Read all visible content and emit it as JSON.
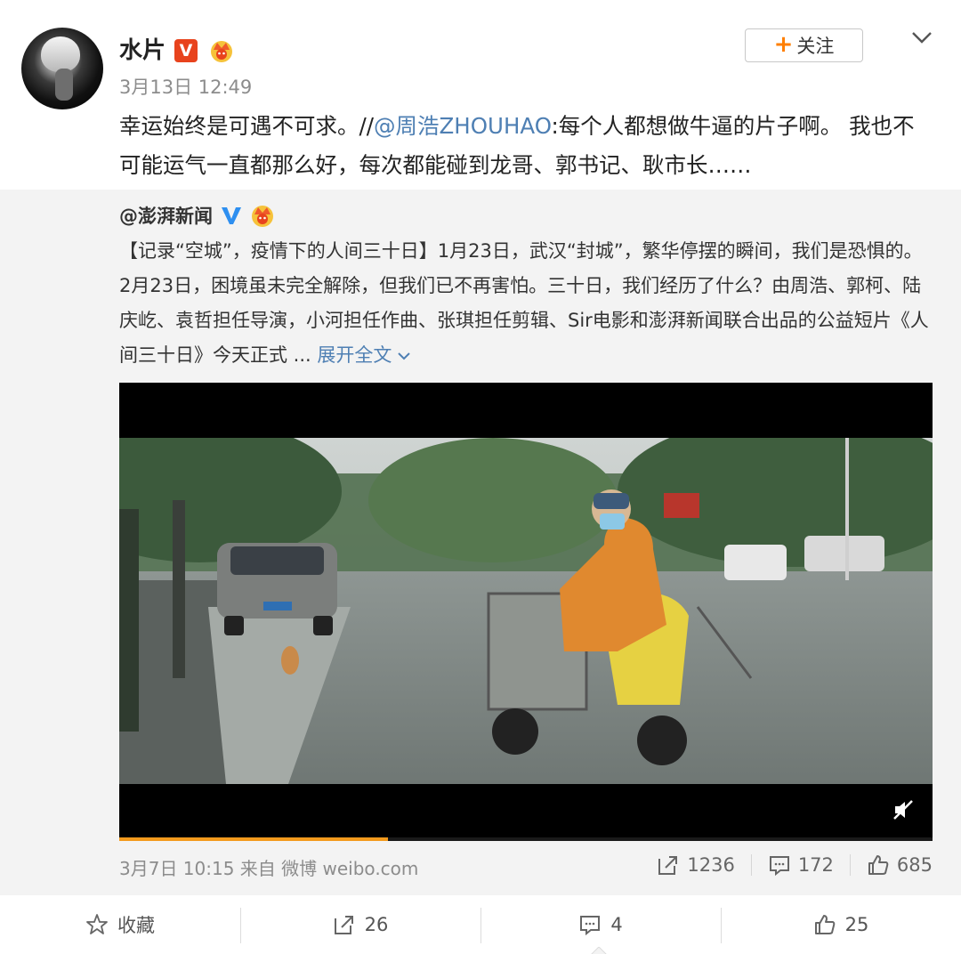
{
  "post": {
    "author": "水片",
    "verified_badge": "V",
    "timestamp": "3月13日 12:49",
    "follow_label": "关注",
    "text_before": "幸运始终是可遇不可求。//",
    "mention": "@周浩ZHOUHAO",
    "text_after": ":每个人都想做牛逼的片子啊。 我也不可能运气一直都那么好，每次都能碰到龙哥、郭书记、耿市长……"
  },
  "repost": {
    "source_name": "@澎湃新闻",
    "text": "【记录“空城”，疫情下的人间三十日】1月23日，武汉“封城”，繁华停摆的瞬间，我们是恐惧的。2月23日，困境虽未完全解除，但我们已不再害怕。三十日，我们经历了什么？由周浩、郭柯、陆庆屹、袁哲担任导演，小河担任作曲、张琪担任剪辑、Sir电影和澎湃新闻联合出品的公益短片《人间三十日》今天正式 ...",
    "expand_label": "展开全文",
    "video": {
      "progress": 0.33,
      "muted": true
    },
    "meta": "3月7日 10:15 来自 微博 weibo.com",
    "reposts": "1236",
    "comments": "172",
    "likes": "685"
  },
  "actions": {
    "favorite_label": "收藏",
    "repost_count": "26",
    "comment_count": "4",
    "like_count": "25"
  },
  "colors": {
    "link": "#4e7fb3",
    "follow_plus": "#ff7f00",
    "verified_orange": "#e8431d",
    "verified_blue": "#2e8ff0",
    "progress": "#f39a1d"
  },
  "icons": [
    "v-badge-icon",
    "crown-icon",
    "plus-icon",
    "chevron-down-icon",
    "mute-icon",
    "repost-icon",
    "comment-icon",
    "like-icon",
    "star-icon"
  ]
}
